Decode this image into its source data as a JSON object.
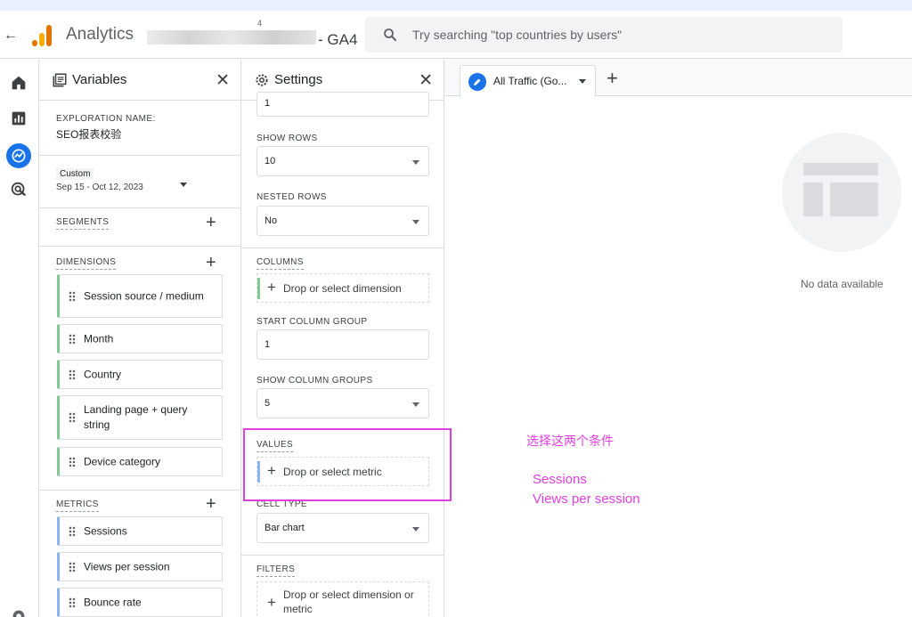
{
  "header": {
    "app_name": "Analytics",
    "property_small": "4",
    "property_suffix": "- GA4",
    "search_placeholder": "Try searching \"top countries by users\""
  },
  "colors": {
    "accent": "#1a73e8",
    "dimension_bar": "#81c995",
    "metric_bar": "#8ab4f8",
    "annotation": "#e040e0"
  },
  "rail": {
    "icons": [
      "home-icon",
      "reports-icon",
      "explore-icon",
      "advertising-icon",
      "settings-icon"
    ]
  },
  "variables": {
    "title": "Variables",
    "exploration_label": "EXPLORATION NAME:",
    "exploration_name": "SEO报表校验",
    "date_label": "Custom",
    "date_range": "Sep 15 - Oct 12, 2023",
    "segments_label": "SEGMENTS",
    "dimensions_label": "DIMENSIONS",
    "dimensions": [
      "Session source / medium",
      "Month",
      "Country",
      "Landing page + query string",
      "Device category"
    ],
    "metrics_label": "METRICS",
    "metrics": [
      "Sessions",
      "Views per session",
      "Bounce rate"
    ]
  },
  "settings": {
    "title": "Settings",
    "top_partial_value": "1",
    "show_rows_label": "SHOW ROWS",
    "show_rows_value": "10",
    "nested_rows_label": "NESTED ROWS",
    "nested_rows_value": "No",
    "columns_label": "COLUMNS",
    "columns_drop": "Drop or select dimension",
    "start_column_group_label": "START COLUMN GROUP",
    "start_column_group_value": "1",
    "show_column_groups_label": "SHOW COLUMN GROUPS",
    "show_column_groups_value": "5",
    "values_label": "VALUES",
    "values_drop": "Drop or select metric",
    "cell_type_label": "CELL TYPE",
    "cell_type_value": "Bar chart",
    "filters_label": "FILTERS",
    "filters_drop": "Drop or select dimension or metric"
  },
  "main": {
    "tab_label": "All Traffic (Go...",
    "no_data": "No data available"
  },
  "annotation": {
    "title": "选择这两个条件",
    "line1": "Sessions",
    "line2": "Views per session"
  }
}
